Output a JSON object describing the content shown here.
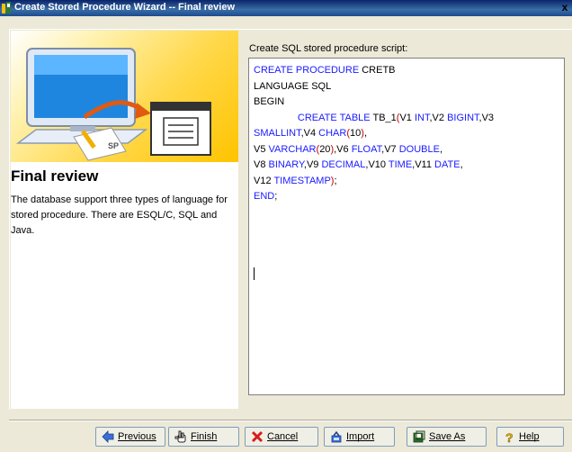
{
  "window": {
    "title": "Create Stored Procedure Wizard -- Final review",
    "close_glyph": "x"
  },
  "left": {
    "heading": "Final review",
    "description": "The database support three types of language for stored procedure. There are ESQL/C, SQL and Java.",
    "illustration_label": "SP"
  },
  "script": {
    "label": "Create SQL stored procedure script:",
    "lines": [
      "CREATE PROCEDURE CRETB",
      "LANGUAGE SQL",
      "BEGIN",
      "                CREATE TABLE TB_1(V1 INT,V2 BIGINT,V3",
      "SMALLINT,V4 CHAR(10),",
      "V5 VARCHAR(20),V6 FLOAT,V7 DOUBLE,",
      "V8 BINARY,V9 DECIMAL,V10 TIME,V11 DATE,",
      "V12 TIMESTAMP);",
      "END;"
    ]
  },
  "buttons": {
    "previous": "Previous",
    "finish": "Finish",
    "cancel": "Cancel",
    "import": "Import",
    "save_as": "Save As",
    "help": "Help"
  },
  "colors": {
    "keyword": "#1a1aff",
    "paren": "#c00000",
    "title_bar": "#0a246a",
    "banner": "#ffd84a"
  },
  "icons": [
    "wizard-app-icon",
    "left-arrow-icon",
    "finish-hand-icon",
    "cancel-x-icon",
    "import-icon",
    "save-as-icon",
    "help-question-icon"
  ]
}
